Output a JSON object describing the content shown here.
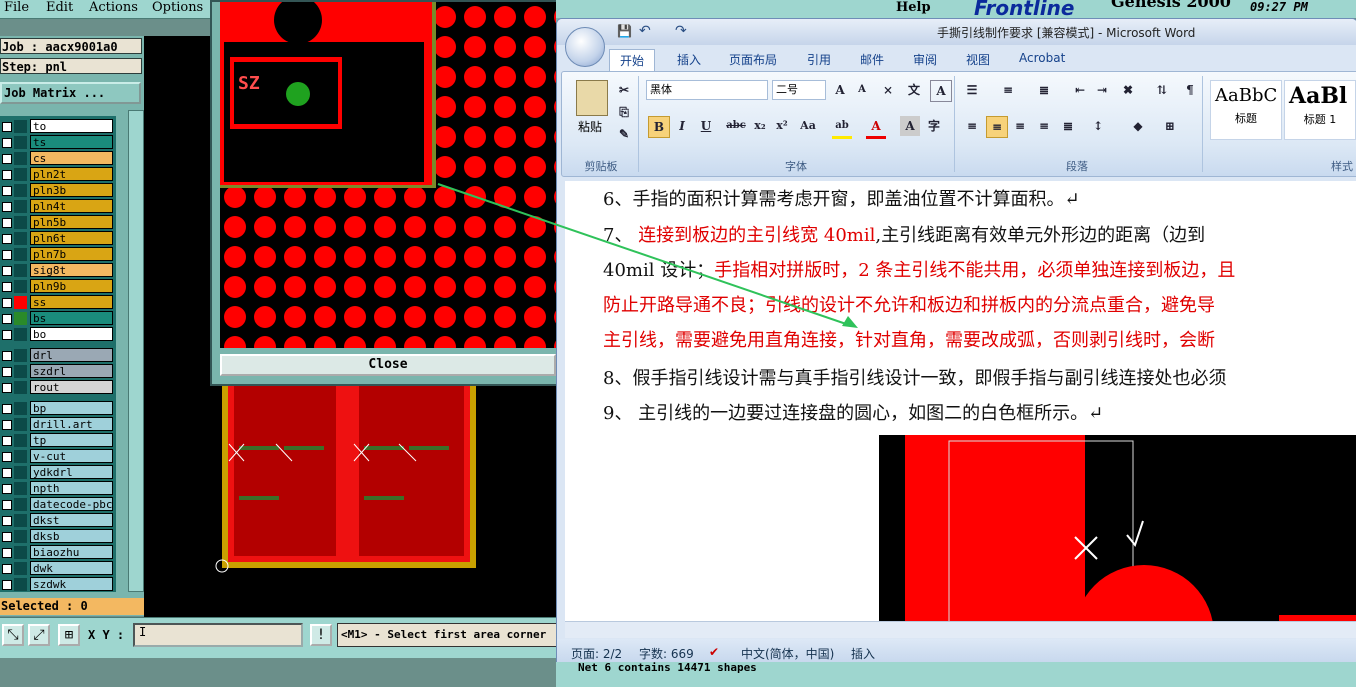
{
  "genesis": {
    "menu": [
      "File",
      "Edit",
      "Actions",
      "Options"
    ],
    "job": "Job : aacx9001a0",
    "step": "Step: pnl",
    "job_matrix_button": "Job Matrix ...",
    "layers": [
      {
        "name": "to",
        "color": "#ffffff"
      },
      {
        "name": "ts",
        "color": "#1a8c7c"
      },
      {
        "name": "cs",
        "color": "#f3b861"
      },
      {
        "name": "pln2t",
        "color": "#d9a514"
      },
      {
        "name": "pln3b",
        "color": "#d9a514"
      },
      {
        "name": "pln4t",
        "color": "#d9a514"
      },
      {
        "name": "pln5b",
        "color": "#d9a514"
      },
      {
        "name": "pln6t",
        "color": "#d9a514"
      },
      {
        "name": "pln7b",
        "color": "#d9a514"
      },
      {
        "name": "sig8t",
        "color": "#f3b861"
      },
      {
        "name": "pln9b",
        "color": "#d9a514"
      },
      {
        "name": "ss",
        "color": "#d9a514"
      },
      {
        "name": "bs",
        "color": "#1a8c7c"
      },
      {
        "name": "bo",
        "color": "#ffffff"
      },
      {
        "name": "drl",
        "color": "#9aa8b4"
      },
      {
        "name": "szdrl",
        "color": "#9aa8b4"
      },
      {
        "name": "rout",
        "color": "#d4d4d4"
      },
      {
        "name": "bp",
        "color": "#9fd0da"
      },
      {
        "name": "drill.art",
        "color": "#9fd0da"
      },
      {
        "name": "tp",
        "color": "#9fd0da"
      },
      {
        "name": "v-cut",
        "color": "#9fd0da"
      },
      {
        "name": "ydkdrl",
        "color": "#9fd0da"
      },
      {
        "name": "npth",
        "color": "#9fd0da"
      },
      {
        "name": "datecode-pbc",
        "color": "#9fd0da"
      },
      {
        "name": "dkst",
        "color": "#9fd0da"
      },
      {
        "name": "dksb",
        "color": "#9fd0da"
      },
      {
        "name": "biaozhu",
        "color": "#9fd0da"
      },
      {
        "name": "dwk",
        "color": "#9fd0da"
      },
      {
        "name": "szdwk",
        "color": "#9fd0da"
      }
    ],
    "selected": "Selected : 0",
    "xy_label": "X Y :",
    "xy_value": "I",
    "message": "<M1> - Select first area corner",
    "popup_close": "Close",
    "popup_silk_text": "SZ",
    "help": "Help",
    "brand": "Frontline",
    "product": "Genesis 2000",
    "time": "09:27 PM",
    "status_bottom": "Net 6 contains 14471 shapes"
  },
  "word": {
    "title": "手撕引线制作要求 [兼容模式] - Microsoft Word",
    "tabs": [
      "开始",
      "插入",
      "页面布局",
      "引用",
      "邮件",
      "审阅",
      "视图",
      "Acrobat"
    ],
    "font_name": "黑体",
    "font_size": "二号",
    "groups": {
      "clipboard": "剪贴板",
      "font": "字体",
      "paragraph": "段落",
      "styles": "样式"
    },
    "paste_label": "粘贴",
    "styles": [
      {
        "sample": "AaBbC",
        "name": "标题"
      },
      {
        "sample": "AaBl",
        "name": "标题 1"
      }
    ],
    "lines": [
      {
        "parts": [
          {
            "t": "6、手指的面积计算需考虑开窗，即盖油位置不计算面积。↵",
            "red": false
          }
        ]
      },
      {
        "parts": [
          {
            "t": "7、 ",
            "red": false
          },
          {
            "t": "连接到板边的主引线宽 40mil",
            "red": true
          },
          {
            "t": ",主引线距离有效单元外形边的距离（边到",
            "red": false
          }
        ]
      },
      {
        "parts": [
          {
            "t": "40mil 设计；",
            "red": false
          },
          {
            "t": "手指相对拼版时，2 条主引线不能共用，必须单独连接到板边，且",
            "red": true
          }
        ]
      },
      {
        "parts": [
          {
            "t": "防止开路导通不良；引线的设计不允许和板边和拼板内的分流点重合，避免导",
            "red": true
          }
        ]
      },
      {
        "parts": [
          {
            "t": "主引线，需要避免用直角连接，针对直角，需要改成弧，否则剥引线时，会断",
            "red": true
          }
        ]
      },
      {
        "parts": [
          {
            "t": "8、假手指引线设计需与真手指引线设计一致，即假手指与副引线连接处也必须",
            "red": false
          }
        ]
      },
      {
        "parts": [
          {
            "t": "9、 主引线的一边要过连接盘的圆心，如图二的白色框所示。↵",
            "red": false
          }
        ]
      }
    ],
    "status": {
      "page": "页面: 2/2",
      "words": "字数: 669",
      "lang": "中文(简体，中国)",
      "mode": "插入"
    }
  }
}
